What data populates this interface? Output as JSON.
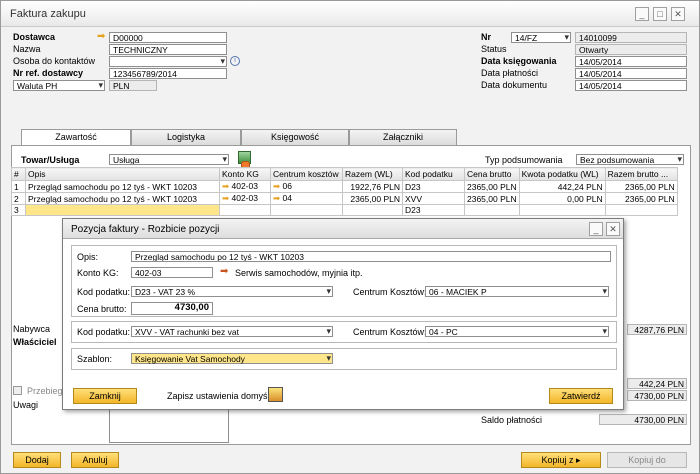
{
  "window": {
    "title": "Faktura zakupu",
    "min": "_",
    "max": "□",
    "close": "✕"
  },
  "header": {
    "dostawca_label": "Dostawca",
    "dostawca": "D00000",
    "nazwa_label": "Nazwa",
    "nazwa": "TECHNICZNY",
    "osoba_label": "Osoba do kontaktów",
    "osoba": "",
    "nrref_label": "Nr ref. dostawcy",
    "nrref": "123456789/2014",
    "waluta": "Waluta PH",
    "waluta_val": "PLN",
    "nr_label": "Nr",
    "nr_series": "14/FZ",
    "nr_val": "14010099",
    "status_label": "Status",
    "status": "Otwarty",
    "data_ks_label": "Data księgowania",
    "data_ks": "14/05/2014",
    "data_pl_label": "Data płatności",
    "data_pl": "14/05/2014",
    "data_dok_label": "Data dokumentu",
    "data_dok": "14/05/2014"
  },
  "tabs": [
    "Zawartość",
    "Logistyka",
    "Księgowość",
    "Załączniki"
  ],
  "items": {
    "towar_label": "Towar/Usługa",
    "towar_val": "Usługa",
    "typ_label": "Typ podsumowania",
    "typ_val": "Bez podsumowania"
  },
  "grid": {
    "headers": [
      "#",
      "Opis",
      "Konto KG",
      "Centrum kosztów",
      "Razem (WL)",
      "Kod podatku",
      "Cena brutto",
      "Kwota podatku (WL)",
      "Razem brutto ..."
    ],
    "rows": [
      [
        "1",
        "Przegląd samochodu po 12 tyś - WKT 10203",
        "402-03",
        "06",
        "1922,76 PLN",
        "D23",
        "2365,00 PLN",
        "442,24 PLN",
        "2365,00 PLN"
      ],
      [
        "2",
        "Przegląd samochodu po 12 tyś - WKT 10203",
        "402-03",
        "04",
        "2365,00 PLN",
        "XVV",
        "2365,00 PLN",
        "0,00 PLN",
        "2365,00 PLN"
      ],
      [
        "3",
        "",
        "",
        "",
        "",
        "D23",
        "",
        "",
        ""
      ]
    ]
  },
  "footer": {
    "nabywca": "Nabywca",
    "wlasciciel": "Właściciel",
    "przebieg": "Przebieg z",
    "uwagi": "Uwagi",
    "sum1": "4287,76 PLN",
    "sum2": "442,24 PLN",
    "sum3": "4730,00 PLN",
    "saldo_label": "Saldo płatności",
    "saldo": "4730,00 PLN",
    "dodaj": "Dodaj",
    "anuluj": "Anuluj",
    "kopiuj_z": "Kopiuj z",
    "kopiuj_do": "Kopiuj do"
  },
  "dialog": {
    "title": "Pozycja faktury - Rozbicie pozycji",
    "opis_label": "Opis:",
    "opis": "Przegląd samochodu po 12 tyś - WKT 10203",
    "konto_label": "Konto KG:",
    "konto": "402-03",
    "konto_desc": "Serwis samochodów, myjnia itp.",
    "kod1_label": "Kod podatku:",
    "kod1": "D23 - VAT   23 %",
    "centrum1_label": "Centrum Kosztów:",
    "centrum1": "06 - MACIEK P",
    "cena_label": "Cena brutto:",
    "cena": "4730,00",
    "kod2_label": "Kod podatku:",
    "kod2": "XVV - VAT rachunki bez vat",
    "centrum2_label": "Centrum Kosztów:",
    "centrum2": "04 - PC",
    "szablon_label": "Szablon:",
    "szablon": "Księgowanie Vat Samochody",
    "zamknij": "Zamknij",
    "zapisz_label": "Zapisz ustawienia domyślne:",
    "zatwierdz": "Zatwierdź"
  },
  "colors": {
    "accent": "#f2b52a",
    "arrow": "#e6a11f",
    "selection": "#ffe68a"
  }
}
